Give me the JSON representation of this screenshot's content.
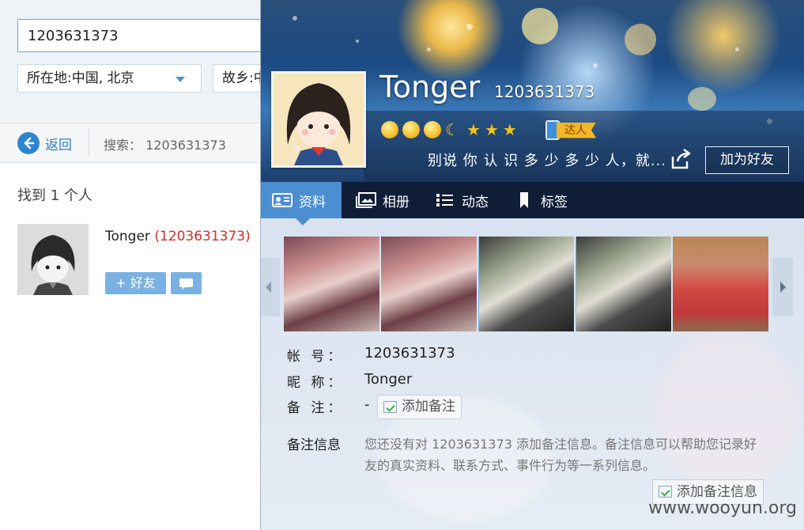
{
  "search": {
    "query": "1203631373",
    "location_filter": "所在地:中国, 北京",
    "hometown_filter": "故乡:中"
  },
  "nav": {
    "back_label": "返回",
    "search_label": "搜索： 1203631373"
  },
  "results": {
    "found_text": "找到 1 个人",
    "items": [
      {
        "name": "Tonger",
        "number": "(1203631373)",
        "add_button": "+ 好友"
      }
    ]
  },
  "profile": {
    "name": "Tonger",
    "number": "1203631373",
    "level_icons": [
      "sun-icon",
      "sun-icon",
      "sun-icon",
      "moon-icon",
      "star-icon",
      "star-icon",
      "star-icon"
    ],
    "talent_badge": "达人",
    "signature": "别说 你 认 识 多   少 多 少 人，就...",
    "add_friend_label": "加为好友",
    "tabs": [
      "资料",
      "相册",
      "动态",
      "标签"
    ],
    "info": {
      "account_key": "帐  号：",
      "account_value": "1203631373",
      "nickname_key": "昵  称：",
      "nickname_value": "Tonger",
      "remark_key": "备  注：",
      "remark_value": "-",
      "add_remark_label": "添加备注"
    },
    "remark_info": {
      "title": "备注信息",
      "description": "您还没有对 1203631373 添加备注信息。备注信息可以帮助您记录好友的真实资料、联系方式、事件行为等一系列信息。",
      "button": "添加备注信息"
    }
  },
  "watermark": "www.wooyun.org",
  "colors": {
    "accent": "#2e85cf",
    "highlight_number": "#d42c2c",
    "tab_active": "#4c8ed2",
    "button_light": "#7bb1e2"
  }
}
